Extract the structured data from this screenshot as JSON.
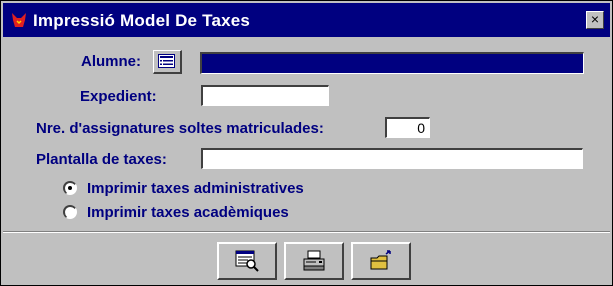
{
  "window": {
    "title": "Impressió Model De Taxes",
    "close_label": "×",
    "title_icon": "app-icon"
  },
  "form": {
    "alumne_label": "Alumne:",
    "alumne_value": "",
    "expedient_label": "Expedient:",
    "expedient_value": "",
    "nre_label": "Nre. d'assignatures soltes matriculades:",
    "nre_value": "0",
    "plantilla_label": "Plantalla de taxes:",
    "plantilla_value": ""
  },
  "options": [
    {
      "label": "Imprimir taxes administratives",
      "selected": true
    },
    {
      "label": "Imprimir taxes acadèmiques",
      "selected": false
    }
  ],
  "toolbar": {
    "buttons": [
      {
        "icon": "preview-icon"
      },
      {
        "icon": "printer-icon"
      },
      {
        "icon": "open-folder-icon"
      }
    ]
  },
  "colors": {
    "titlebar": "#000080",
    "label_text": "#000080",
    "face": "#c0c0c0"
  }
}
